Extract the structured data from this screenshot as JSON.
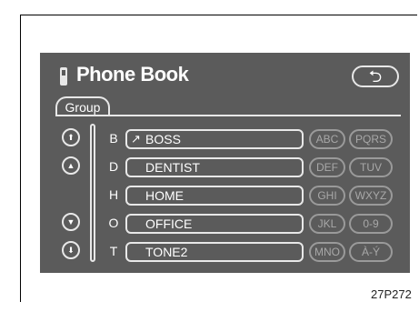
{
  "header": {
    "title": "Phone Book",
    "back_icon": "return-arrow-icon",
    "phone_icon": "phone-icon"
  },
  "tabs": {
    "group_label": "Group"
  },
  "scroll": {
    "page_up_icon": "double-up-arrow-icon",
    "up_icon": "up-arrow-icon",
    "down_icon": "down-arrow-icon",
    "page_down_icon": "double-down-arrow-icon"
  },
  "entries": [
    {
      "letter": "B",
      "name": "BOSS",
      "marker": "↗"
    },
    {
      "letter": "D",
      "name": "DENTIST",
      "marker": ""
    },
    {
      "letter": "H",
      "name": "HOME",
      "marker": ""
    },
    {
      "letter": "O",
      "name": "OFFICE",
      "marker": ""
    },
    {
      "letter": "T",
      "name": "TONE2",
      "marker": ""
    }
  ],
  "keys_left": [
    "ABC",
    "DEF",
    "GHI",
    "JKL",
    "MNO"
  ],
  "keys_right": [
    "PQRS",
    "TUV",
    "WXYZ",
    "0-9",
    "À-Ý"
  ],
  "figure_code": "27P272",
  "colors": {
    "screen_bg": "#5b5b5b",
    "frame_line": "#e8e8e8",
    "disabled_key": "#9a9a9a"
  }
}
